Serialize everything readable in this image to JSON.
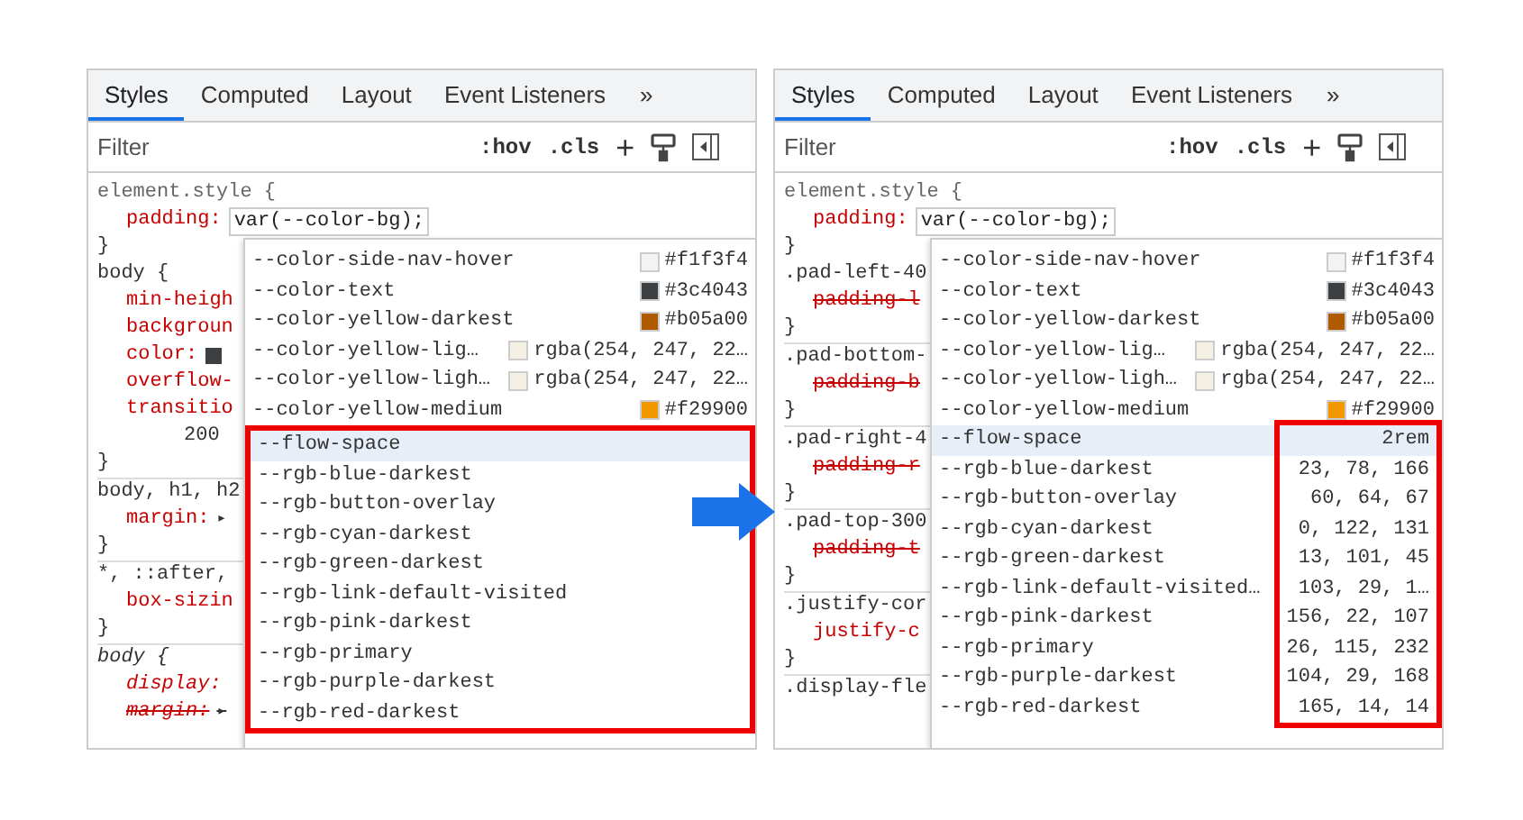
{
  "panels": [
    {
      "tabs": [
        {
          "label": "Styles",
          "selected": true
        },
        {
          "label": "Computed",
          "selected": false
        },
        {
          "label": "Layout",
          "selected": false
        },
        {
          "label": "Event Listeners",
          "selected": false
        }
      ],
      "more": "»",
      "filter_placeholder": "Filter",
      "hov": ":hov",
      "cls": ".cls",
      "add": "+",
      "element_style": {
        "selector": "element.style {",
        "property": "padding:",
        "value": "var(--color-bg);",
        "close": "}"
      },
      "rules": [
        {
          "kind": "selector",
          "text": "body {",
          "italic": false
        },
        {
          "kind": "property",
          "name": "min-heigh",
          "struck": false,
          "italic": false
        },
        {
          "kind": "property",
          "name": "backgroun",
          "struck": false,
          "italic": false
        },
        {
          "kind": "property",
          "name": "color:",
          "color": "#3c4043",
          "struck": false,
          "italic": false
        },
        {
          "kind": "property",
          "name": "overflow-",
          "struck": false,
          "italic": false
        },
        {
          "kind": "property",
          "name": "transitio",
          "struck": false,
          "italic": false
        },
        {
          "kind": "value",
          "text": "200"
        },
        {
          "kind": "close",
          "text": "}"
        },
        {
          "kind": "selector",
          "text": "body, h1, h2",
          "italic": false
        },
        {
          "kind": "property",
          "name": "margin:",
          "rest": "▸",
          "struck": false,
          "italic": false
        },
        {
          "kind": "close",
          "text": "}"
        },
        {
          "kind": "selector",
          "text": "*, ::after,",
          "italic": false
        },
        {
          "kind": "property",
          "name": "box-sizin",
          "struck": false,
          "italic": false
        },
        {
          "kind": "close",
          "text": "}"
        },
        {
          "kind": "selector",
          "text": "body {",
          "italic": true
        },
        {
          "kind": "property",
          "name": "display:",
          "struck": false,
          "italic": true
        },
        {
          "kind": "property",
          "name": "margin:",
          "rest": "▸",
          "struck": true,
          "italic": true
        }
      ],
      "dropdown": {
        "kind": "rows",
        "items": [
          {
            "name": "--color-side-nav-hover",
            "value": "#f1f3f4",
            "color": "#f1f3f4",
            "selected": false
          },
          {
            "name": "--color-text",
            "value": "#3c4043",
            "color": "#3c4043",
            "selected": false
          },
          {
            "name": "--color-yellow-darkest",
            "value": "#b05a00",
            "color": "#b05a00",
            "selected": false
          },
          {
            "name": "--color-yellow-lig…",
            "value": "rgba(254, 247, 22…",
            "color": "#f4f1e4",
            "selected": false
          },
          {
            "name": "--color-yellow-ligh…",
            "value": "rgba(254, 247, 22…",
            "color": "#f4f1e4",
            "selected": false
          },
          {
            "name": "--color-yellow-medium",
            "value": "#f29900",
            "color": "#f29900",
            "selected": false
          }
        ],
        "marked_items": [
          {
            "name": "--flow-space",
            "selected": true
          },
          {
            "name": "--rgb-blue-darkest",
            "selected": false
          },
          {
            "name": "--rgb-button-overlay",
            "selected": false
          },
          {
            "name": "--rgb-cyan-darkest",
            "selected": false
          },
          {
            "name": "--rgb-green-darkest",
            "selected": false
          },
          {
            "name": "--rgb-link-default-visited",
            "selected": false
          },
          {
            "name": "--rgb-pink-darkest",
            "selected": false
          },
          {
            "name": "--rgb-primary",
            "selected": false
          },
          {
            "name": "--rgb-purple-darkest",
            "selected": false
          },
          {
            "name": "--rgb-red-darkest",
            "selected": false
          }
        ]
      }
    },
    {
      "tabs": [
        {
          "label": "Styles",
          "selected": true
        },
        {
          "label": "Computed",
          "selected": false
        },
        {
          "label": "Layout",
          "selected": false
        },
        {
          "label": "Event Listeners",
          "selected": false
        }
      ],
      "more": "»",
      "filter_placeholder": "Filter",
      "hov": ":hov",
      "cls": ".cls",
      "add": "+",
      "element_style": {
        "selector": "element.style {",
        "property": "padding:",
        "value": "var(--color-bg);",
        "close": "}"
      },
      "rules": [
        {
          "kind": "selector",
          "text": ".pad-left-40",
          "italic": false
        },
        {
          "kind": "property",
          "name": "padding-l",
          "struck": true,
          "italic": false
        },
        {
          "kind": "close",
          "text": "}"
        },
        {
          "kind": "selector",
          "text": ".pad-bottom-",
          "italic": false
        },
        {
          "kind": "property",
          "name": "padding-b",
          "struck": true,
          "italic": false
        },
        {
          "kind": "close",
          "text": "}"
        },
        {
          "kind": "selector",
          "text": ".pad-right-4",
          "italic": false
        },
        {
          "kind": "property",
          "name": "padding-r",
          "struck": true,
          "italic": false
        },
        {
          "kind": "close",
          "text": "}"
        },
        {
          "kind": "selector",
          "text": ".pad-top-300",
          "italic": false
        },
        {
          "kind": "property",
          "name": "padding-t",
          "struck": true,
          "italic": false
        },
        {
          "kind": "close",
          "text": "}"
        },
        {
          "kind": "selector",
          "text": ".justify-cor",
          "italic": false
        },
        {
          "kind": "property",
          "name": "justify-c",
          "struck": false,
          "italic": false
        },
        {
          "kind": "close",
          "text": "}"
        },
        {
          "kind": "selector",
          "text": ".display-fle",
          "italic": false
        }
      ],
      "dropdown": {
        "kind": "values",
        "items": [
          {
            "name": "--color-side-nav-hover",
            "value": "#f1f3f4",
            "color": "#f1f3f4",
            "selected": false
          },
          {
            "name": "--color-text",
            "value": "#3c4043",
            "color": "#3c4043",
            "selected": false
          },
          {
            "name": "--color-yellow-darkest",
            "value": "#b05a00",
            "color": "#b05a00",
            "selected": false
          },
          {
            "name": "--color-yellow-lig…",
            "value": "rgba(254, 247, 22…",
            "color": "#f4f1e4",
            "selected": false
          },
          {
            "name": "--color-yellow-ligh…",
            "value": "rgba(254, 247, 22…",
            "color": "#f4f1e4",
            "selected": false
          },
          {
            "name": "--color-yellow-medium",
            "value": "#f29900",
            "color": "#f29900",
            "selected": false
          }
        ],
        "marked_items": [
          {
            "name": "--flow-space",
            "value": "2rem",
            "selected": true
          },
          {
            "name": "--rgb-blue-darkest",
            "value": "23, 78, 166",
            "selected": false
          },
          {
            "name": "--rgb-button-overlay",
            "value": "60, 64, 67",
            "selected": false
          },
          {
            "name": "--rgb-cyan-darkest",
            "value": "0, 122, 131",
            "selected": false
          },
          {
            "name": "--rgb-green-darkest",
            "value": "13, 101, 45",
            "selected": false
          },
          {
            "name": "--rgb-link-default-visited…",
            "value": "103, 29, 1…",
            "selected": false
          },
          {
            "name": "--rgb-pink-darkest",
            "value": "156, 22, 107",
            "selected": false
          },
          {
            "name": "--rgb-primary",
            "value": "26, 115, 232",
            "selected": false
          },
          {
            "name": "--rgb-purple-darkest",
            "value": "104, 29, 168",
            "selected": false
          },
          {
            "name": "--rgb-red-darkest",
            "value": "165, 14, 14",
            "selected": false
          }
        ]
      }
    }
  ]
}
